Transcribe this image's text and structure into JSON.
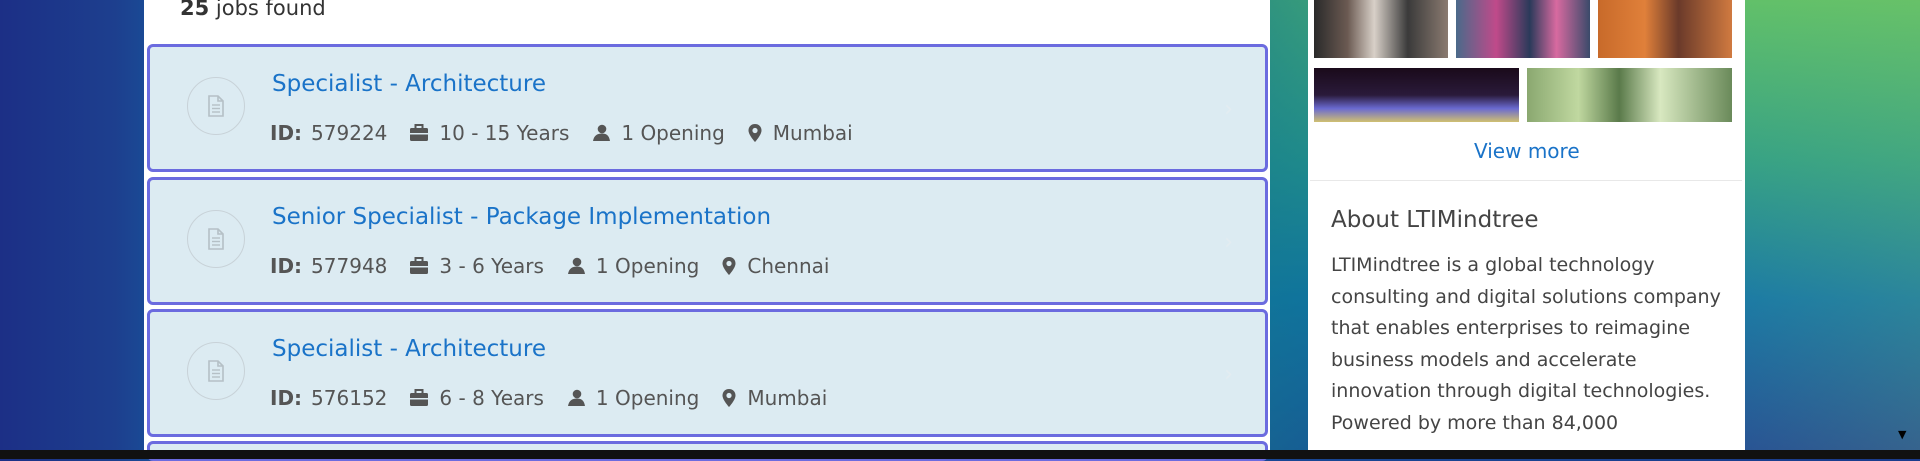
{
  "results": {
    "count": "25",
    "suffix": " jobs found"
  },
  "jobs": [
    {
      "title": "Specialist - Architecture",
      "id_label": "ID:",
      "id": "579224",
      "experience": "10 - 15 Years",
      "openings": "1 Opening",
      "location": "Mumbai"
    },
    {
      "title": "Senior Specialist - Package Implementation",
      "id_label": "ID:",
      "id": "577948",
      "experience": "3 - 6 Years",
      "openings": "1 Opening",
      "location": "Chennai"
    },
    {
      "title": "Specialist - Architecture",
      "id_label": "ID:",
      "id": "576152",
      "experience": "6 - 8 Years",
      "openings": "1 Opening",
      "location": "Mumbai"
    }
  ],
  "sidebar": {
    "view_more": "View more",
    "about_heading": "About LTIMindtree",
    "about_text": "LTIMindtree is a global technology consulting and digital solutions company that enables enterprises to reimagine business models and accelerate innovation through digital technologies. Powered by more than 84,000"
  },
  "icons": {
    "document": "document-icon",
    "briefcase": "briefcase-icon",
    "person": "person-icon",
    "location": "location-pin-icon",
    "chevron": "chevron-right-icon"
  },
  "colors": {
    "accent": "#1a73c8",
    "card_bg": "#dcebf2",
    "card_border": "#6b6bdf"
  }
}
